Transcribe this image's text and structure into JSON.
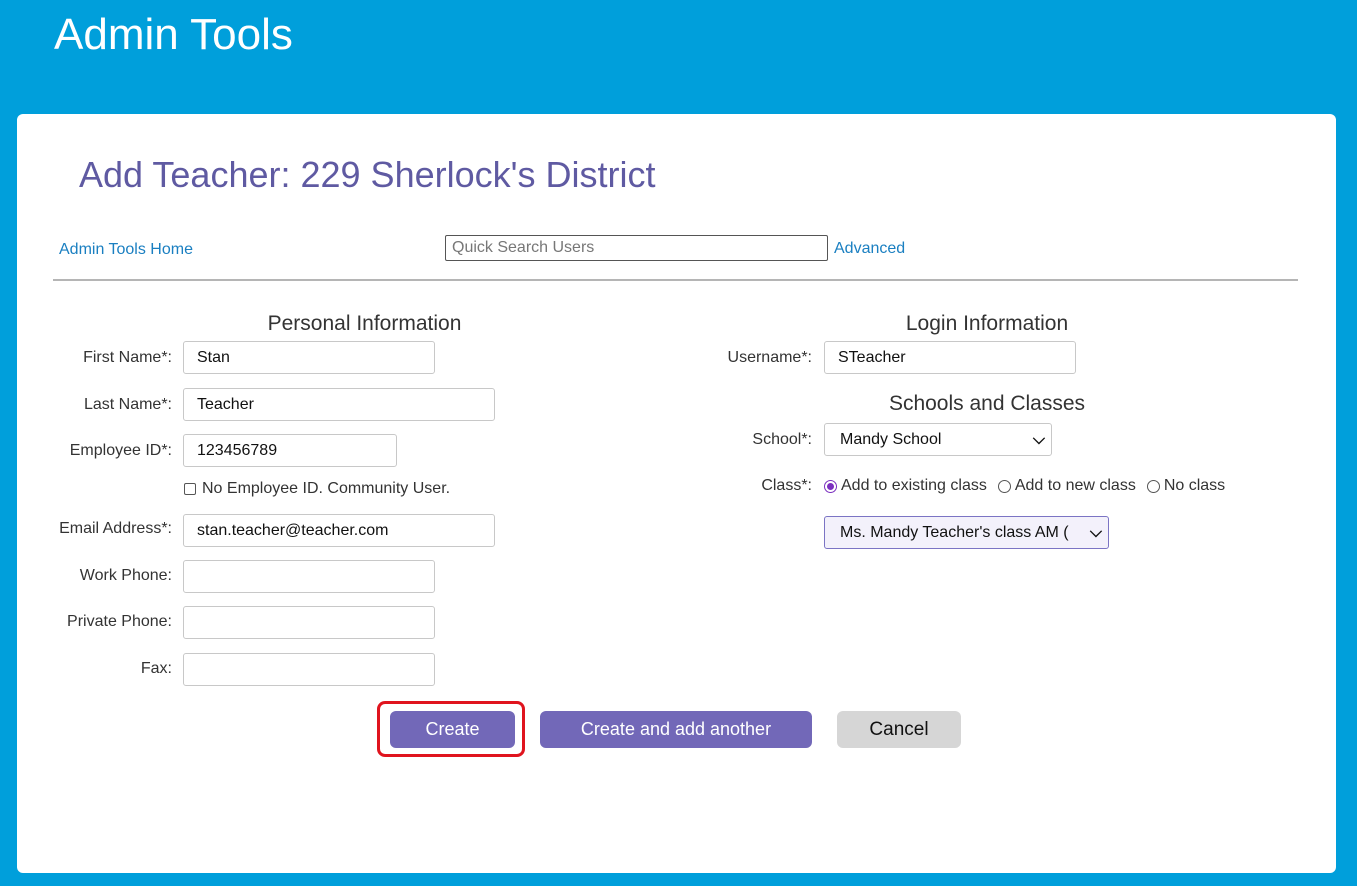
{
  "header": {
    "app_title": "Admin Tools"
  },
  "page": {
    "title": "Add Teacher: 229 Sherlock's District",
    "home_link": "Admin Tools Home",
    "search_placeholder": "Quick Search Users",
    "advanced_link": "Advanced"
  },
  "personal": {
    "section_title": "Personal Information",
    "first_name": {
      "label": "First Name*:",
      "value": "Stan"
    },
    "last_name": {
      "label": "Last Name*:",
      "value": "Teacher"
    },
    "employee_id": {
      "label": "Employee ID*:",
      "value": "123456789"
    },
    "no_employee_checkbox": {
      "label": "No Employee ID. Community User.",
      "checked": false
    },
    "email": {
      "label": "Email Address*:",
      "value": "stan.teacher@teacher.com"
    },
    "work_phone": {
      "label": "Work Phone:",
      "value": ""
    },
    "private_phone": {
      "label": "Private Phone:",
      "value": ""
    },
    "fax": {
      "label": "Fax:",
      "value": ""
    }
  },
  "login": {
    "section_title": "Login Information",
    "username": {
      "label": "Username*:",
      "value": "STeacher"
    }
  },
  "schools": {
    "section_title": "Schools and Classes",
    "school": {
      "label": "School*:",
      "value": "Mandy School"
    },
    "class": {
      "label": "Class*:",
      "options": [
        "Add to existing class",
        "Add to new class",
        "No class"
      ],
      "selected": "Add to existing class",
      "existing_class_value": "Ms. Mandy Teacher's class AM ("
    }
  },
  "actions": {
    "create": "Create",
    "create_another": "Create and add another",
    "cancel": "Cancel"
  },
  "colors": {
    "header_bg": "#009fdb",
    "title_color": "#5f5aa2",
    "primary_button": "#7268b8",
    "cancel_button": "#d6d6d6",
    "link_color": "#1a7fc1",
    "highlight": "#e0141e"
  }
}
